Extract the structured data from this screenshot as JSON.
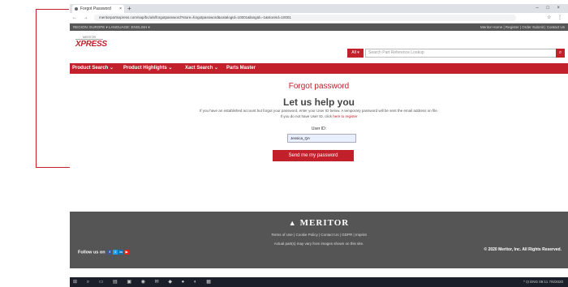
{
  "browser": {
    "tab_title": "Forgot Password",
    "tab_close": "×",
    "new_tab": "+",
    "window_controls": "–  □  ×",
    "nav_buttons": "← → C ⌂",
    "url": "meritorpartsxpress.com/sap/bc/ui5/forgotpassword?store=forgotpassword&catalogId=10001&langId=-1&storeId=10001",
    "addr_icons": "☆ ⋮"
  },
  "topstrip": {
    "left": "REGION: EUROPE ▾     LANGUAGE: ENGLISH ▾",
    "right": "Meritor Home | Register | Order Submit | Contact Us"
  },
  "header": {
    "logo_top": "MERITOR",
    "logo_main": "XPRESS",
    "search_select": "All ▾",
    "search_placeholder": "Search Part Reference Lookup",
    "search_icon": "🔍"
  },
  "nav": {
    "items": [
      "Product Search ⌄",
      "Product Highlights ⌄",
      "Xact Search ⌄",
      "Parts Master"
    ]
  },
  "content": {
    "title": "Forgot password",
    "subtitle": "Let us help you",
    "desc1": "If you have an established account but forgot your password, enter your User ID below. A temporary password will be sent the email address on file.",
    "desc2_a": "If you do not have User ID, click ",
    "desc2_link": "here to register",
    "userid_label": "User ID:",
    "userid_value": "Jessica_QA",
    "send_button": "Send me my password"
  },
  "footer": {
    "brand": "MERITOR",
    "links": "Terms of Use  |  Cookie Policy  |  Contact Us  |  GDPR  |  Imprint",
    "disclaimer": "Actual part(s) may vary from images shown on this site.",
    "follow": "Follow us on",
    "copyright": "© 2020 Meritor, Inc. All Rights Reserved."
  },
  "taskbar": {
    "icons": "⊞ ⌕ ▭ ▤ ▣ ◉ ✉ ◆ ● ◐ ▦",
    "right": "^ ⊡ ENG  09:11  7/6/2020"
  },
  "colors": {
    "brand_red": "#c2202a",
    "footer_gray": "#555555"
  }
}
